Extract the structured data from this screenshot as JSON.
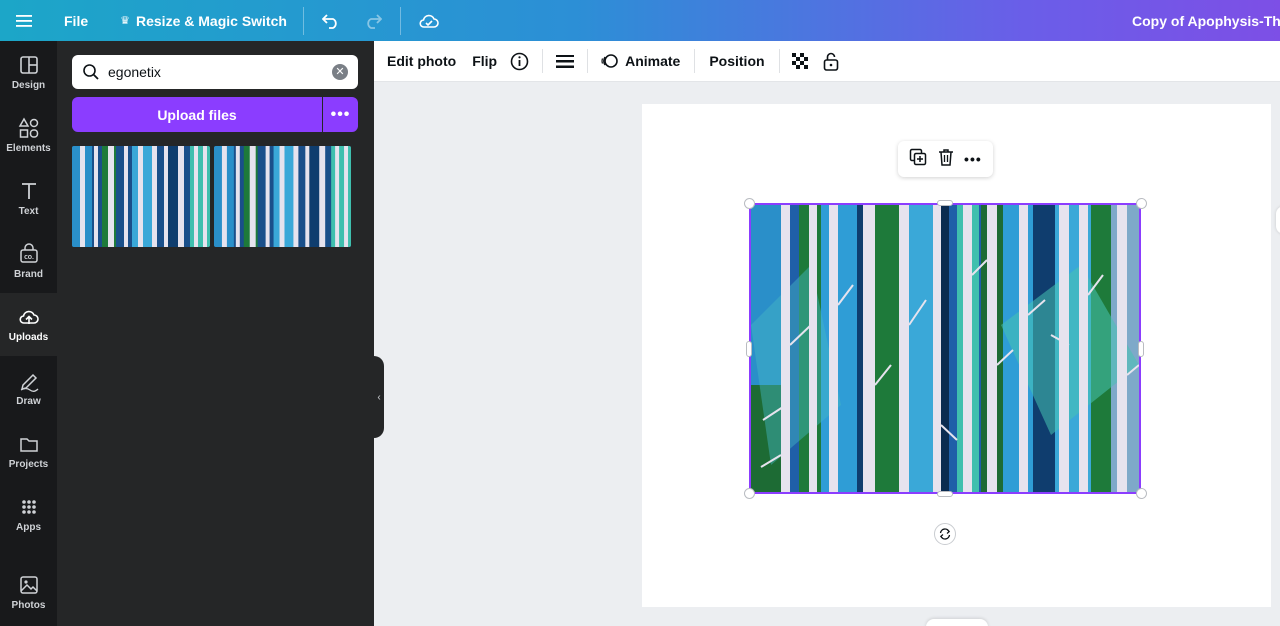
{
  "topbar": {
    "file_label": "File",
    "resize_label": "Resize & Magic Switch",
    "doc_title": "Copy of Apophysis-ThePa"
  },
  "rail": [
    {
      "label": "Design",
      "icon": "layout-icon"
    },
    {
      "label": "Elements",
      "icon": "shapes-icon"
    },
    {
      "label": "Text",
      "icon": "text-icon"
    },
    {
      "label": "Brand",
      "icon": "brand-icon"
    },
    {
      "label": "Uploads",
      "icon": "upload-cloud-icon"
    },
    {
      "label": "Draw",
      "icon": "pen-icon"
    },
    {
      "label": "Projects",
      "icon": "folder-icon"
    },
    {
      "label": "Apps",
      "icon": "grid-icon"
    },
    {
      "label": "Photos",
      "icon": "image-icon"
    }
  ],
  "panel": {
    "search_value": "egonetix",
    "upload_label": "Upload files"
  },
  "toolbar": {
    "edit_photo": "Edit photo",
    "flip": "Flip",
    "animate": "Animate",
    "position": "Position"
  },
  "colors": {
    "accent": "#8b3dff",
    "rail_bg": "#18191b",
    "panel_bg": "#252627"
  }
}
